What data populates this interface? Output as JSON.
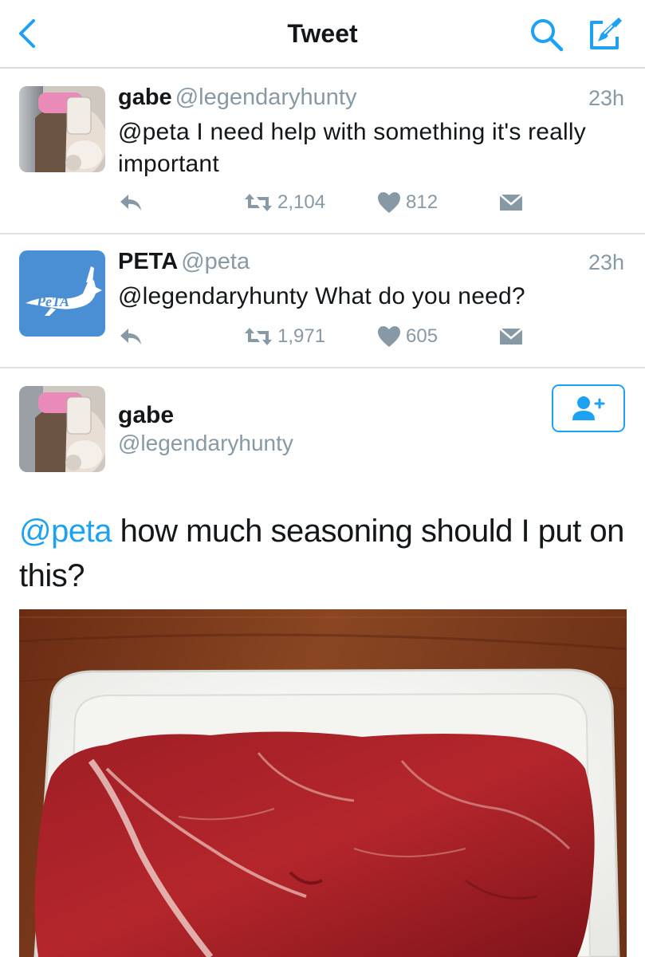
{
  "nav": {
    "title": "Tweet",
    "back_icon": "chevron-left-icon",
    "search_icon": "search-icon",
    "compose_icon": "compose-icon"
  },
  "tweets": [
    {
      "name": "gabe",
      "handle": "@legendaryhunty",
      "time": "23h",
      "text": "@peta I need help with something it's really important",
      "retweets": "2,104",
      "likes": "812"
    },
    {
      "name": "PETA",
      "handle": "@peta",
      "time": "23h",
      "text": "@legendaryhunty What do you need?",
      "retweets": "1,971",
      "likes": "605",
      "avatar_logo_text": "PeTA"
    }
  ],
  "main": {
    "name": "gabe",
    "handle": "@legendaryhunty",
    "mention": "@peta",
    "text": " how much seasoning should I put on this?",
    "follow_icon": "add-user-icon"
  },
  "colors": {
    "accent": "#1da1f2",
    "muted": "#8899a6",
    "peta_blue": "#4a8fd4"
  }
}
